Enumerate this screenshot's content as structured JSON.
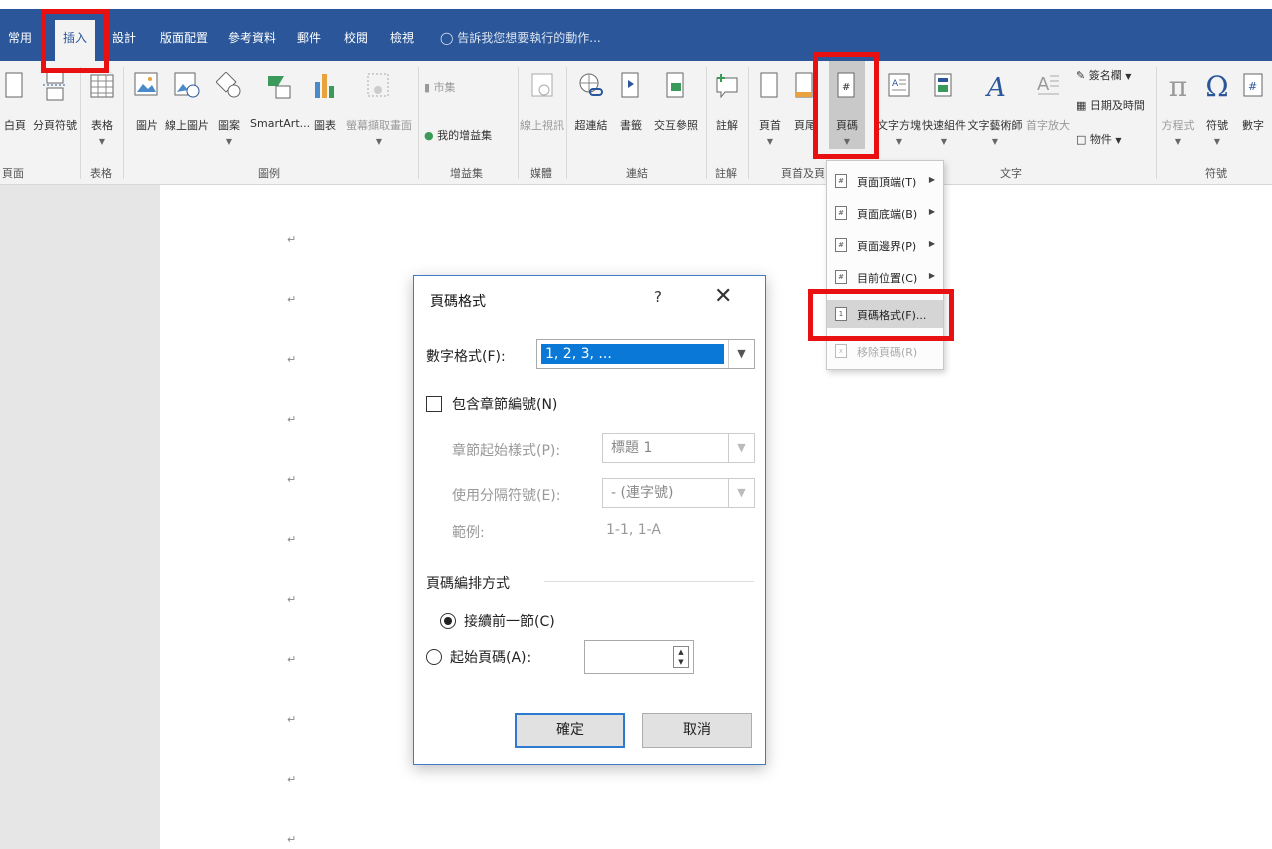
{
  "tabs": [
    {
      "label": "常用"
    },
    {
      "label": "插入"
    },
    {
      "label": "設計"
    },
    {
      "label": "版面配置"
    },
    {
      "label": "參考資料"
    },
    {
      "label": "郵件"
    },
    {
      "label": "校閱"
    },
    {
      "label": "檢視"
    }
  ],
  "tellme": "告訴我您想要執行的動作...",
  "ribbon": {
    "buttons": {
      "page_partial": "白頁",
      "page_break": "分頁符號",
      "table": "表格",
      "picture": "圖片",
      "online_picture": "線上圖片",
      "shapes": "圖案",
      "smartart": "SmartArt...",
      "chart": "圖表",
      "screenshot": "螢幕擷取畫面",
      "store": "市集",
      "my_addins": "我的增益集",
      "online_video": "線上視訊",
      "hyperlink": "超連結",
      "bookmark": "書籤",
      "cross_ref": "交互參照",
      "comment": "註解",
      "header": "頁首",
      "footer": "頁尾",
      "page_number": "頁碼",
      "text_box": "文字方塊",
      "quick_parts": "快速組件",
      "wordart": "文字藝術師",
      "dropcap": "首字放大",
      "signature": "簽名欄",
      "datetime": "日期及時間",
      "object": "物件",
      "equation": "方程式",
      "symbol": "符號",
      "number": "數字"
    },
    "groups": {
      "pages": "頁面",
      "tables": "表格",
      "illustrations": "圖例",
      "addins": "增益集",
      "media": "媒體",
      "links": "連結",
      "comments": "註解",
      "headerfooter": "頁首及頁",
      "text": "文字",
      "symbols": "符號"
    }
  },
  "menu": {
    "items": [
      {
        "label": "頁面頂端(T)"
      },
      {
        "label": "頁面底端(B)"
      },
      {
        "label": "頁面邊界(P)"
      },
      {
        "label": "目前位置(C)"
      },
      {
        "label": "頁碼格式(F)..."
      },
      {
        "label": "移除頁碼(R)"
      }
    ]
  },
  "dialog": {
    "title": "頁碼格式",
    "help": "?",
    "close": "✕",
    "number_format_label": "數字格式(F):",
    "number_format_value": "1, 2, 3, ...",
    "include_chapter_label": "包含章節編號(N)",
    "chapter_style_label": "章節起始樣式(P):",
    "chapter_style_value": "標題 1",
    "separator_label": "使用分隔符號(E):",
    "separator_value": "-  (連字號)",
    "example_label": "範例:",
    "example_value": "1-1, 1-A",
    "numbering_header": "頁碼編排方式",
    "continue_label": "接續前一節(C)",
    "start_at_label": "起始頁碼(A):",
    "ok": "確定",
    "cancel": "取消"
  },
  "paragraph_mark": "↵"
}
